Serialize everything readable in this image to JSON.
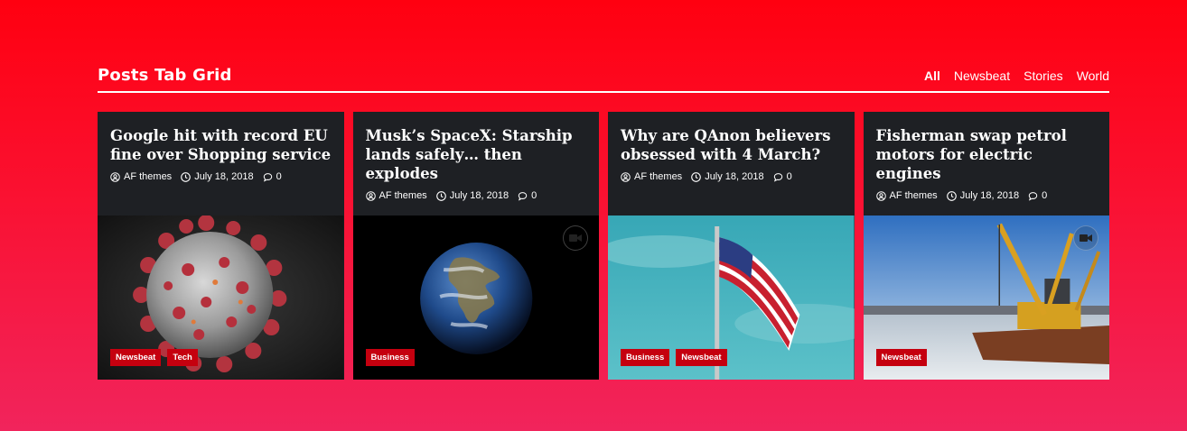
{
  "section": {
    "title": "Posts Tab Grid"
  },
  "tabs": [
    {
      "label": "All",
      "active": true
    },
    {
      "label": "Newsbeat"
    },
    {
      "label": "Stories"
    },
    {
      "label": "World"
    }
  ],
  "posts": [
    {
      "title": "Google hit with record EU fine over Shopping service",
      "author": "AF themes",
      "date": "July 18, 2018",
      "comments": "0",
      "image": "coronavirus-illustration",
      "video": false,
      "tags": [
        "Newsbeat",
        "Tech"
      ]
    },
    {
      "title": "Musk’s SpaceX: Starship lands safely… then explodes",
      "author": "AF themes",
      "date": "July 18, 2018",
      "comments": "0",
      "image": "earth-from-space",
      "video": true,
      "tags": [
        "Business"
      ]
    },
    {
      "title": "Why are QAnon believers obsessed with 4 March?",
      "author": "AF themes",
      "date": "July 18, 2018",
      "comments": "0",
      "image": "american-flag",
      "video": false,
      "tags": [
        "Business",
        "Newsbeat"
      ]
    },
    {
      "title": "Fisherman swap petrol motors for electric engines",
      "author": "AF themes",
      "date": "July 18, 2018",
      "comments": "0",
      "image": "dredging-ship-harbor",
      "video": true,
      "tags": [
        "Newsbeat"
      ]
    }
  ],
  "colors": {
    "accent": "#c5000f",
    "card_bg": "#1e2024",
    "bg_top": "#ff0010",
    "bg_bottom": "#f1245c"
  }
}
